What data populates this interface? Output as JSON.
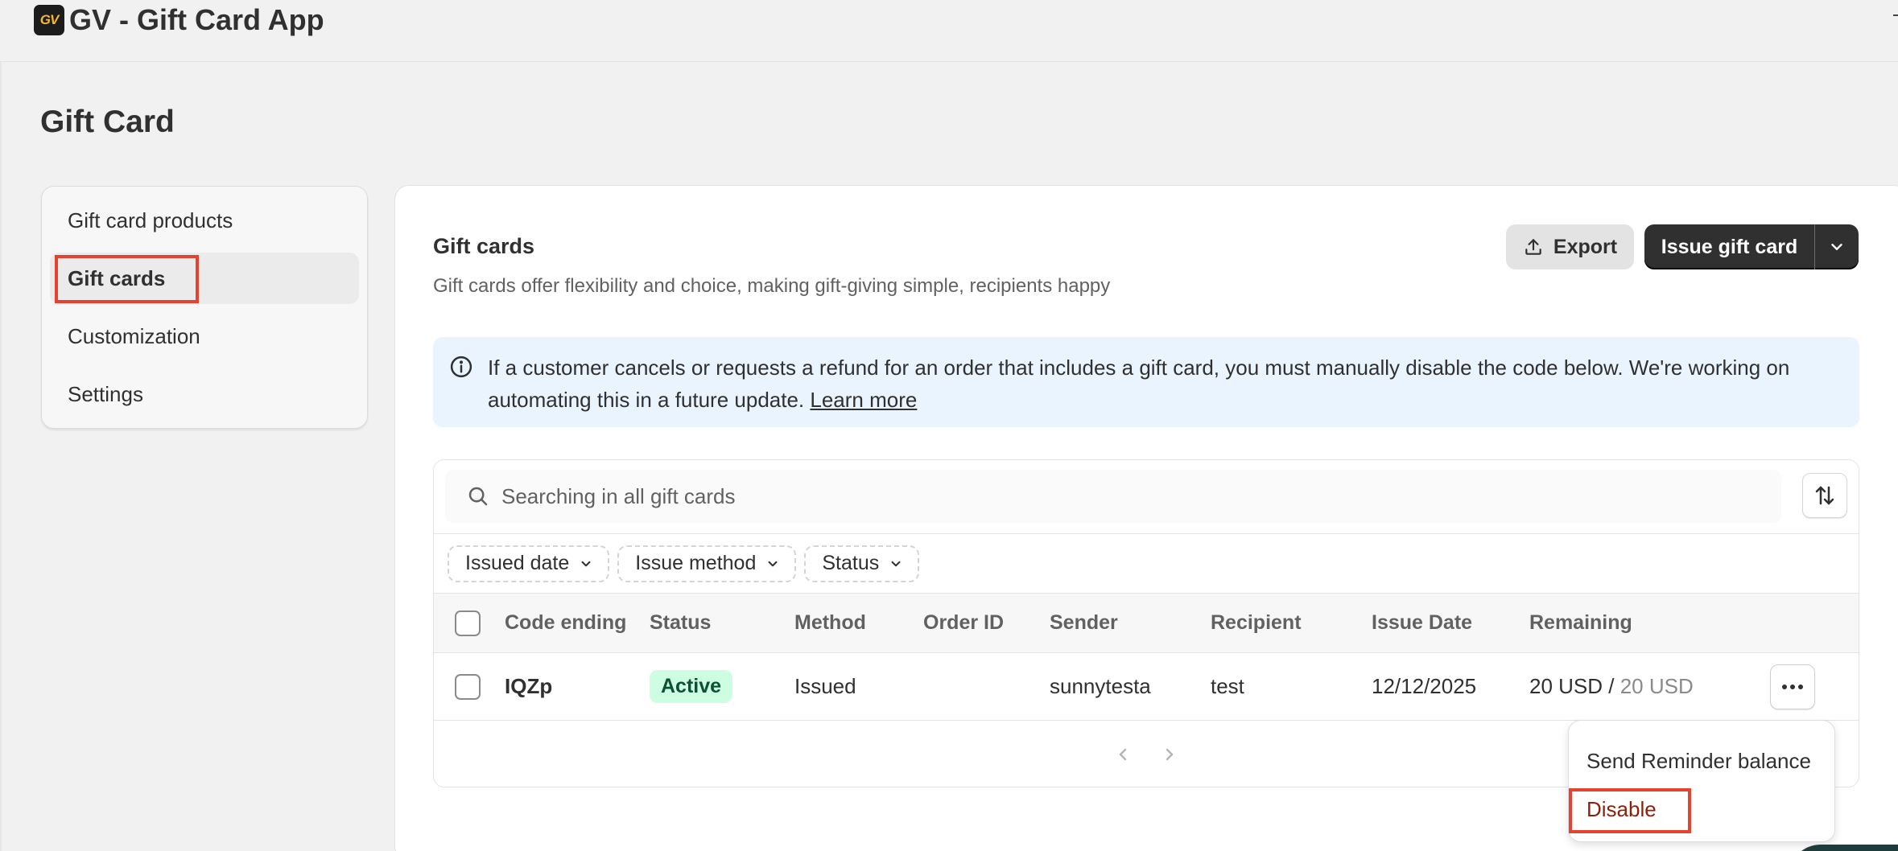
{
  "app": {
    "title": "GV - Gift Card App",
    "logo_text": "GV"
  },
  "page": {
    "title": "Gift Card"
  },
  "nav": {
    "items": [
      {
        "label": "Gift card products",
        "active": false
      },
      {
        "label": "Gift cards",
        "active": true
      },
      {
        "label": "Customization",
        "active": false
      },
      {
        "label": "Settings",
        "active": false
      }
    ]
  },
  "card": {
    "title": "Gift cards",
    "subtitle": "Gift cards offer flexibility and choice, making gift-giving simple, recipients happy",
    "export_label": "Export",
    "issue_label": "Issue gift card"
  },
  "banner": {
    "text": "If a customer cancels or requests a refund for an order that includes a gift card, you must manually disable the code below. We're working on automating this in a future update.",
    "link": "Learn more"
  },
  "search": {
    "placeholder": "Searching in all gift cards"
  },
  "filters": [
    "Issued date",
    "Issue method",
    "Status"
  ],
  "table": {
    "columns": [
      "Code ending",
      "Status",
      "Method",
      "Order ID",
      "Sender",
      "Recipient",
      "Issue Date",
      "Remaining"
    ],
    "rows": [
      {
        "code": "IQZp",
        "status": "Active",
        "method": "Issued",
        "order_id": "",
        "sender": "sunnytesta",
        "recipient": "test",
        "issue_date": "12/12/2025",
        "remaining": "20 USD",
        "remaining_sep": " / ",
        "total": "20 USD"
      }
    ]
  },
  "menu": {
    "items": [
      "Send Reminder balance",
      "Disable"
    ]
  },
  "colors": {
    "primary": "#303030",
    "highlight": "#e5432f",
    "active_badge_bg": "#cdfee1",
    "danger": "#8e1f0b",
    "banner_bg": "#eaf4ff"
  }
}
